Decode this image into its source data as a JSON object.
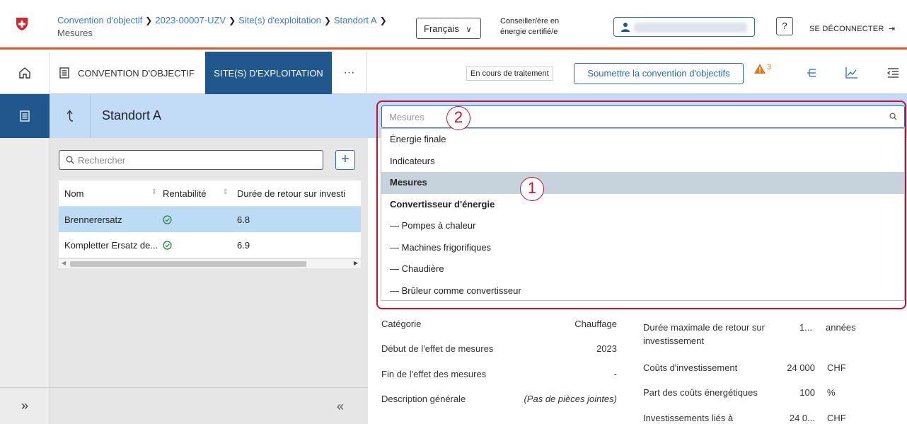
{
  "header": {
    "breadcrumb": [
      "Convention d'objectif",
      "2023-00007-UZV",
      "Site(s) d'exploitation",
      "Standort A"
    ],
    "breadcrumb_last": "Mesures",
    "language": "Français",
    "role_line1": "Conseiller/ère en",
    "role_line2": "énergie certifié/e",
    "help": "?",
    "logout": "SE DÉCONNECTER"
  },
  "nav": {
    "convention": "CONVENTION D'OBJECTIF",
    "sites": "SITE(S) D'EXPLOITATION",
    "more": "···",
    "status": "En cours de traitement",
    "submit": "Soumettre la convention d'objectifs",
    "warning_count": "3"
  },
  "middle": {
    "title": "Standort A",
    "search_placeholder": "Rechercher",
    "add": "+",
    "columns": [
      "Nom",
      "Rentabilité",
      "Durée de retour sur investi"
    ],
    "rows": [
      {
        "name": "Brennerersatz",
        "value": "6.8"
      },
      {
        "name": "Kompletter Ersatz de...",
        "value": "6.9"
      }
    ]
  },
  "right": {
    "search_placeholder": "Mesures",
    "dropdown": [
      "Énergie finale",
      "Indicateurs",
      "Mesures",
      "Convertisseur d'énergie",
      "— Pompes à chaleur",
      "— Machines frigorifiques",
      "— Chaudière",
      "— Brûleur comme convertisseur"
    ],
    "callout1": "1",
    "callout2": "2",
    "details_left": {
      "categorie_label": "Catégorie",
      "categorie_value": "Chauffage",
      "debut_label": "Début de l'effet de mesures",
      "debut_value": "2023",
      "fin_label": "Fin de l'effet des mesures",
      "fin_value": "-",
      "desc_label": "Description générale",
      "desc_value": "(Pas de pièces jointes)"
    },
    "details_right": {
      "duree_label1": "Durée maximale de retour sur",
      "duree_label2": "investissement",
      "duree_value": "1...",
      "duree_unit": "années",
      "couts_label": "Coûts d'investissement",
      "couts_value": "24 000",
      "couts_unit": "CHF",
      "part_label": "Part des coûts énergétiques",
      "part_value": "100",
      "part_unit": "%",
      "invest_label": "Investissements liés à",
      "invest_value": "24 0...",
      "invest_unit": "CHF"
    }
  },
  "colors": {
    "primary": "#20578c",
    "accent_red": "#e2572b",
    "callout_red": "#c8102e",
    "light_blue": "#c2dcf7",
    "warning": "#e8761e"
  }
}
